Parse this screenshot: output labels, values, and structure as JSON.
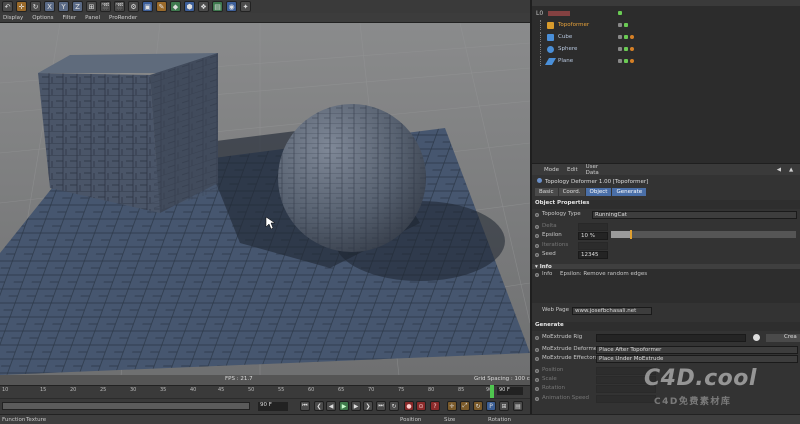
{
  "toolbar": {
    "axis_buttons": [
      "X",
      "Y",
      "Z"
    ]
  },
  "viewport_menu": [
    "Display",
    "Options",
    "Filter",
    "Panel",
    "ProRender"
  ],
  "viewport": {
    "fps": "FPS : 21.7",
    "grid_spacing": "Grid Spacing : 100 cm"
  },
  "timeline": {
    "ticks": [
      "10",
      "15",
      "20",
      "25",
      "30",
      "35",
      "40",
      "45",
      "50",
      "55",
      "60",
      "65",
      "70",
      "75",
      "80",
      "85",
      "90"
    ],
    "current_frame": "90 F"
  },
  "transport": {
    "frame_field": "90 F"
  },
  "bottom_bar": {
    "left": [
      "Function",
      "Texture"
    ],
    "right": [
      "Position",
      "Size",
      "Rotation"
    ]
  },
  "object_manager": {
    "objects": [
      {
        "label": "Topoformer",
        "color": "#d89b2c",
        "kind": "deformer"
      },
      {
        "label": "Cube",
        "color": "#4a8fd8",
        "kind": "cube"
      },
      {
        "label": "Sphere",
        "color": "#4a8fd8",
        "kind": "sphere"
      },
      {
        "label": "Plane",
        "color": "#4a8fd8",
        "kind": "plane"
      }
    ]
  },
  "attribute_manager": {
    "menu": [
      "Mode",
      "Edit",
      "User Data"
    ],
    "title": "Topology Deformer 1.00 [Topoformer]",
    "tabs": [
      "Basic",
      "Coord.",
      "Object",
      "Generate"
    ],
    "active_tab": "Object",
    "object_properties": {
      "header": "Object Properties",
      "topology_type_label": "Topology Type",
      "topology_type_value": "RunningCat",
      "delta_label": "Delta",
      "epsilon_label": "Epsilon",
      "epsilon_value": "10 %",
      "epsilon_fraction": 0.1,
      "iterations_label": "Iterations",
      "seed_label": "Seed",
      "seed_value": "12345"
    },
    "info": {
      "header": "Info",
      "info_label": "Info",
      "info_text": "Epsilon: Remove random edges",
      "web_label": "Web Page",
      "web_value": "www.josefbchasali.net"
    },
    "generate": {
      "header": "Generate",
      "moextrude_rig_label": "MoExtrude Rig",
      "create_label": "Crea",
      "moextrude_deformer_label": "MoExtrude Deformer",
      "moextrude_deformer_value": "Place After Topoformer",
      "moextrude_effectors_label": "MoExtrude Effectors",
      "moextrude_effectors_value": "Place Under MoExtrude",
      "position_label": "Position",
      "scale_label": "Scale",
      "rotation_label": "Rotation",
      "animation_speed_label": "Animation Speed"
    }
  },
  "watermark": {
    "brand": "C4D.cool",
    "subtitle": "C4D免费素材库"
  }
}
